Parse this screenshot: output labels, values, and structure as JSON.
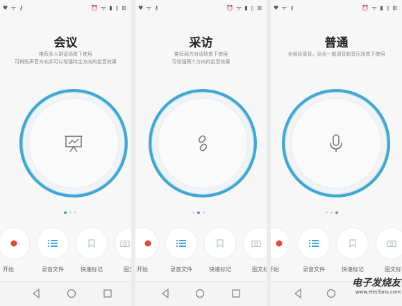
{
  "status_bar": {
    "left_icons": "♥ ᯤ ⚷",
    "right_icons": "⏰ ᯤ ▮ ▯ ⊞"
  },
  "panels": [
    {
      "mode_title": "会议",
      "desc_line1": "推荐多人讲话场景下使用",
      "desc_line2": "可辨别声音方向并可以增强特定方向的拾音效果",
      "center_icon": "presentation-icon",
      "page_indicator_active": 0,
      "buttons": [
        {
          "label": "开始",
          "icon": "record-icon"
        },
        {
          "label": "录音文件",
          "icon": "list-icon"
        },
        {
          "label": "快速标记",
          "icon": "bookmark-icon"
        },
        {
          "label": "图文标",
          "icon": "camera-icon"
        }
      ]
    },
    {
      "mode_title": "采访",
      "desc_line1": "推荐两方对话场景下使用",
      "desc_line2": "可增强两个方向的拾音效果",
      "center_icon": "interview-icon",
      "page_indicator_active": 1,
      "buttons": [
        {
          "label": "开始",
          "icon": "record-icon"
        },
        {
          "label": "录音文件",
          "icon": "list-icon"
        },
        {
          "label": "快速标记",
          "icon": "bookmark-icon"
        },
        {
          "label": "图文标",
          "icon": "camera-icon"
        }
      ]
    },
    {
      "mode_title": "普通",
      "desc_line1": "全频段录音，适合一般语音和音乐场景下使用",
      "desc_line2": "",
      "center_icon": "microphone-icon",
      "page_indicator_active": 2,
      "buttons": [
        {
          "label": "开始",
          "icon": "record-icon"
        },
        {
          "label": "录音文件",
          "icon": "list-icon"
        },
        {
          "label": "快速标记",
          "icon": "bookmark-icon"
        },
        {
          "label": "图文标",
          "icon": "camera-icon"
        }
      ]
    }
  ],
  "navigation": {
    "back": "back-icon",
    "home": "home-icon",
    "recents": "recents-icon"
  },
  "watermark": {
    "main": "电子发烧友",
    "sub": "www.elecfans.com"
  },
  "colors": {
    "accent": "#3fa7d6",
    "record": "#e8463a",
    "icon_gray": "#7a7a7a"
  }
}
